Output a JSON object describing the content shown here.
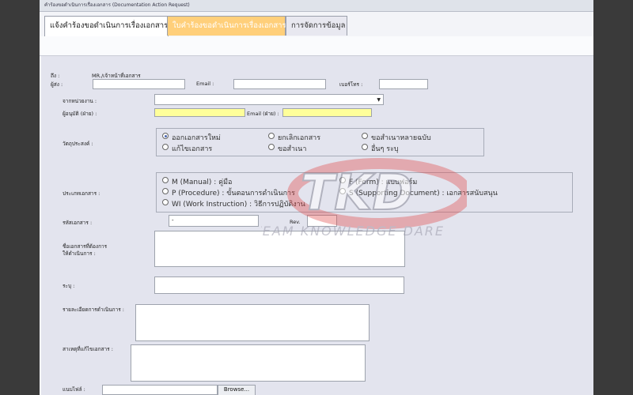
{
  "window": {
    "title": "คำร้องขอดำเนินการเรื่องเอกสาร (Documentation Action Request)"
  },
  "tabs": [
    {
      "label": "แจ้งคำร้องขอดำเนินการเรื่องเอกสาร"
    },
    {
      "label": "ใบคำร้องขอดำเนินการเรื่องเอกสาร"
    },
    {
      "label": "การจัดการข้อมูล"
    }
  ],
  "form": {
    "to_label": "ถึง :",
    "to_value": "MR./เจ้าหน้าที่เอกสาร",
    "sender_label": "ผู้ส่ง :",
    "email_label": "Email :",
    "phone_label": "เบอร์โทร :",
    "department_label": "จากหน่วยงาน :",
    "approver_label": "ผู้อนุมัติ (ฝ่าย) :",
    "approver_email_label": "Email (ฝ่าย) :",
    "objective_label": "วัตถุประสงค์ :",
    "objective_options": [
      {
        "label": "ออกเอกสารใหม่",
        "checked": true
      },
      {
        "label": "ยกเลิกเอกสาร",
        "checked": false
      },
      {
        "label": "ขอสำเนาหลายฉบับ",
        "checked": false
      },
      {
        "label": "แก้ไขเอกสาร",
        "checked": false
      },
      {
        "label": "ขอสำเนา",
        "checked": false
      },
      {
        "label": "อื่นๆ ระบุ",
        "checked": false
      }
    ],
    "doctype_label": "ประเภทเอกสาร :",
    "doctype_options": [
      {
        "label": "M (Manual) : คู่มือ"
      },
      {
        "label": "F (Form) : แบบฟอร์ม"
      },
      {
        "label": "P (Procedure) : ขั้นตอนการดำเนินการ"
      },
      {
        "label": "S (Supporting Document) : เอกสารสนับสนุน"
      },
      {
        "label": "WI (Work Instruction) : วิธีการปฏิบัติงาน"
      }
    ],
    "doccode_label": "รหัสเอกสาร :",
    "doccode_value": "-",
    "rev_label": "Rev.",
    "docname_label_1": "ชื่อเอกสารที่ต้องการ",
    "docname_label_2": "ให้ดำเนินการ :",
    "specify_label": "ระบุ :",
    "details_label": "รายละเอียดการดำเนินการ :",
    "reason_label": "สาเหตุที่แก้ไขเอกสาร :",
    "attach_label": "แนบไฟล์ :",
    "browse_label": "Browse..."
  },
  "watermark": {
    "logo": "TKD",
    "tagline": "TEAM KNOWLEDGE DARE"
  },
  "colors": {
    "tab_active": "#ffffff",
    "tab_highlight": "#ffcf7a",
    "yellow_field": "#ffff9a",
    "watermark": "#e04a4a"
  }
}
